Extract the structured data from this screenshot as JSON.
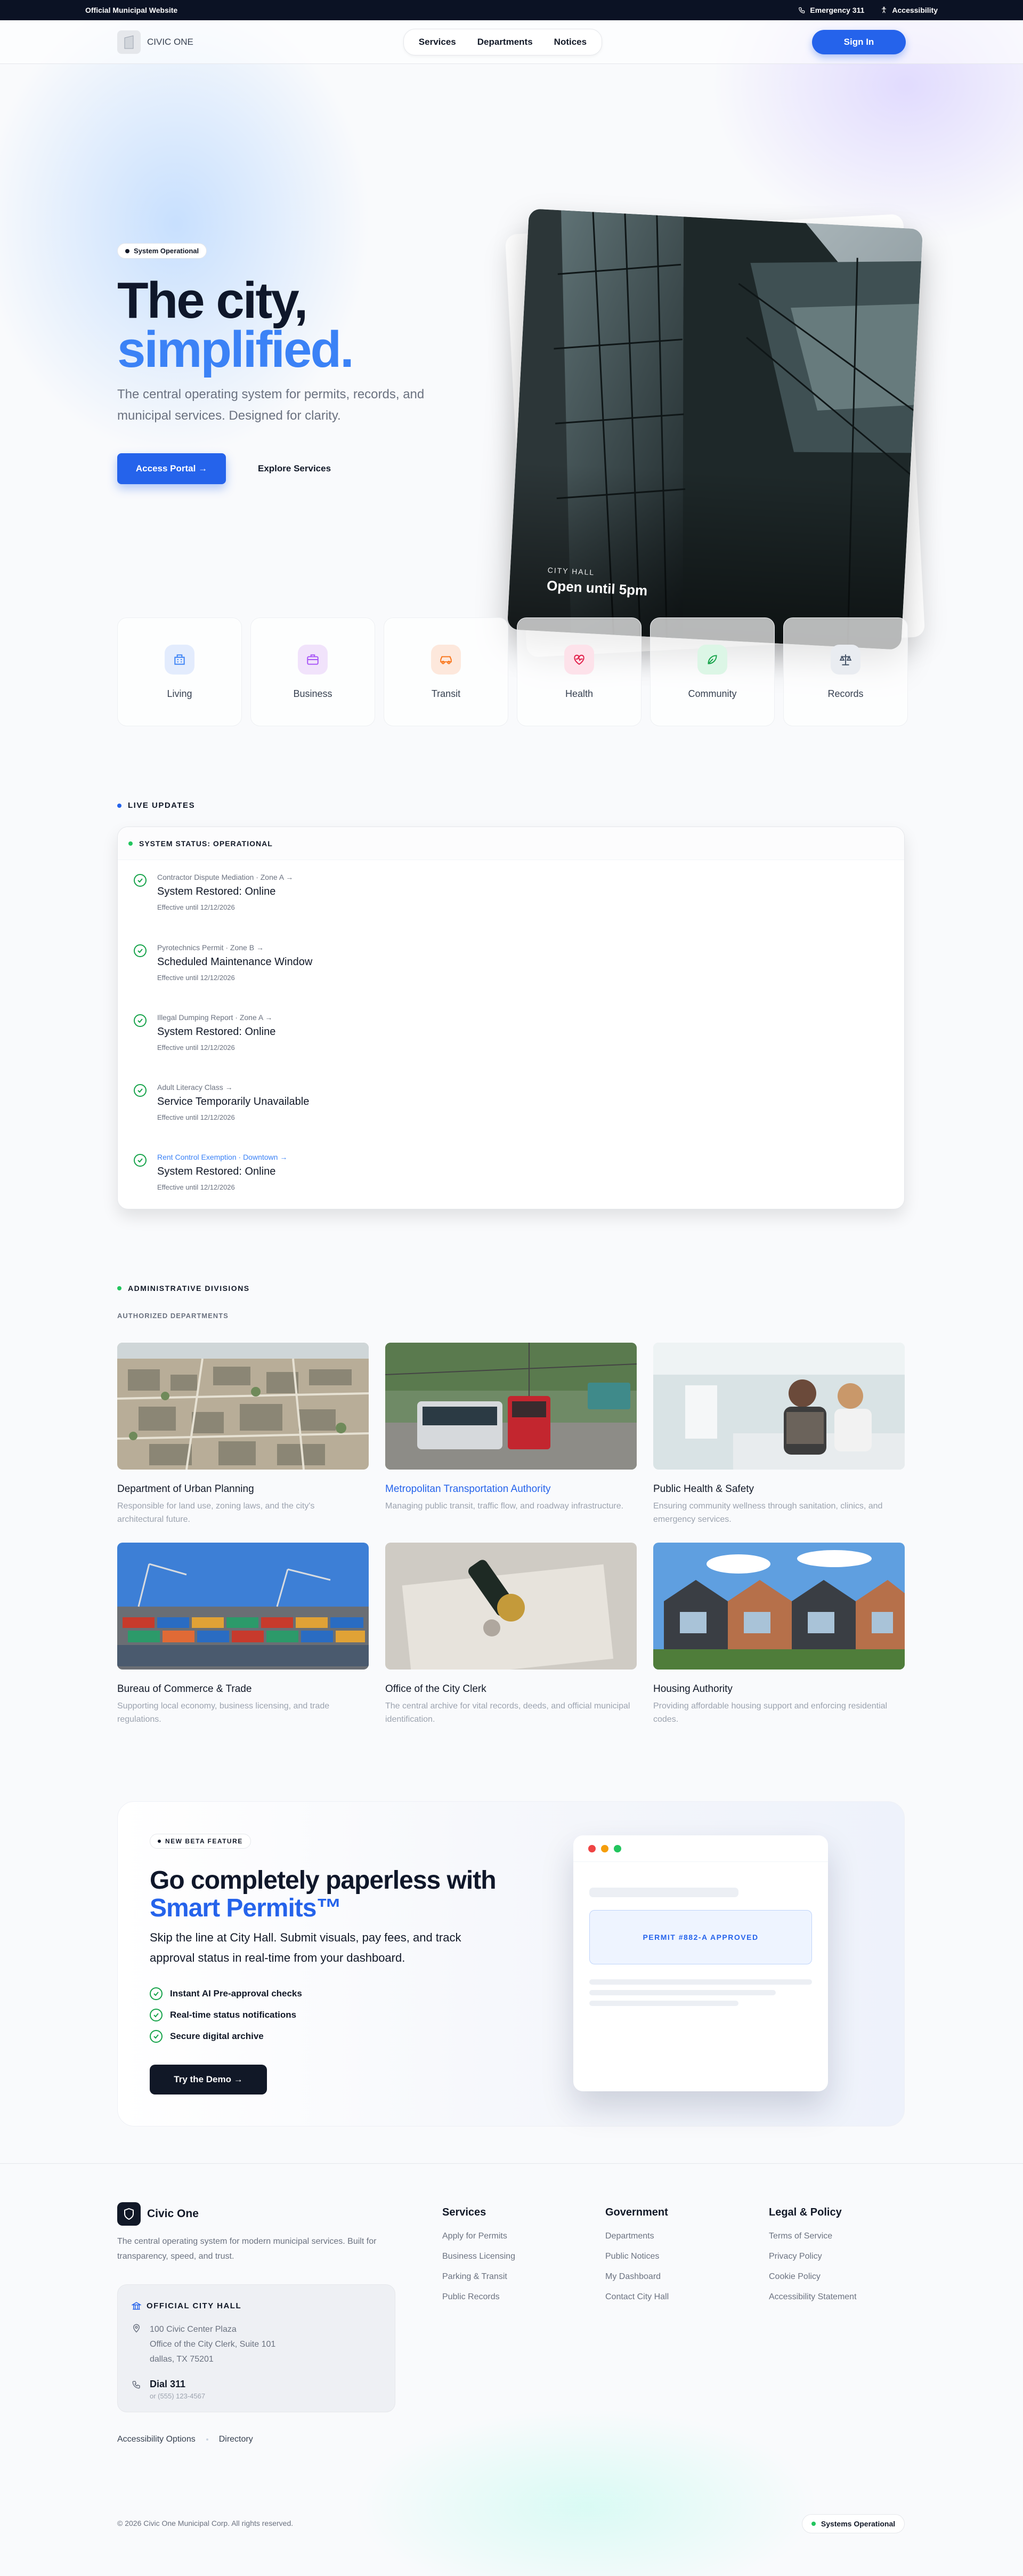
{
  "topbar": {
    "left": "Official Municipal Website",
    "emergency": "Emergency 311",
    "accessibility": "Accessibility"
  },
  "nav": {
    "brand": "CIVIC ONE",
    "links": [
      "Services",
      "Departments",
      "Notices"
    ],
    "signin": "Sign In"
  },
  "hero": {
    "status_pill": "System Operational",
    "title_line1": "The city,",
    "title_line2": "simplified.",
    "lead": "The central operating system for permits, records, and municipal services. Designed for clarity.",
    "primary_cta": "Access Portal →",
    "secondary_cta": "Explore Services",
    "card_eyebrow": "CITY HALL",
    "card_title": "Open until 5pm"
  },
  "categories": [
    {
      "label": "Living",
      "icon": "building-icon",
      "bg": "#e3ecfd",
      "fg": "#3b82f6"
    },
    {
      "label": "Business",
      "icon": "briefcase-icon",
      "bg": "#f1e3fb",
      "fg": "#a855f7"
    },
    {
      "label": "Transit",
      "icon": "car-icon",
      "bg": "#fde8dc",
      "fg": "#f97316"
    },
    {
      "label": "Health",
      "icon": "heart-pulse-icon",
      "bg": "#fde2ea",
      "fg": "#e11d48"
    },
    {
      "label": "Community",
      "icon": "leaf-icon",
      "bg": "#dcf6e6",
      "fg": "#16a34a"
    },
    {
      "label": "Records",
      "icon": "scale-icon",
      "bg": "#e9ecf1",
      "fg": "#475569"
    }
  ],
  "live_updates": {
    "title": "LIVE UPDATES",
    "status_header": "SYSTEM STATUS: OPERATIONAL",
    "items": [
      {
        "meta": "Contractor Dispute Mediation · Zone A →",
        "title": "System Restored: Online",
        "until": "Effective until 12/12/2026"
      },
      {
        "meta": "Pyrotechnics Permit · Zone B →",
        "title": "Scheduled Maintenance Window",
        "until": "Effective until 12/12/2026"
      },
      {
        "meta": "Illegal Dumping Report · Zone A →",
        "title": "System Restored: Online",
        "until": "Effective until 12/12/2026"
      },
      {
        "meta": "Adult Literacy Class →",
        "title": "Service Temporarily Unavailable",
        "until": "Effective until 12/12/2026"
      },
      {
        "meta": "Rent Control Exemption · Downtown →",
        "title": "System Restored: Online",
        "until": "Effective until 12/12/2026"
      }
    ]
  },
  "departments": {
    "title": "ADMINISTRATIVE DIVISIONS",
    "subtitle": "AUTHORIZED DEPARTMENTS",
    "items": [
      {
        "name": "Department of Urban Planning",
        "desc": "Responsible for land use, zoning laws, and the city's architectural future."
      },
      {
        "name": "Metropolitan Transportation Authority",
        "desc": "Managing public transit, traffic flow, and roadway infrastructure."
      },
      {
        "name": "Public Health & Safety",
        "desc": "Ensuring community wellness through sanitation, clinics, and emergency services."
      },
      {
        "name": "Bureau of Commerce & Trade",
        "desc": "Supporting local economy, business licensing, and trade regulations."
      },
      {
        "name": "Office of the City Clerk",
        "desc": "The central archive for vital records, deeds, and official municipal identification."
      },
      {
        "name": "Housing Authority",
        "desc": "Providing affordable housing support and enforcing residential codes."
      }
    ]
  },
  "beta": {
    "pill": "NEW BETA FEATURE",
    "title_line1": "Go completely paperless with",
    "title_line2": "Smart Permits™",
    "body": "Skip the line at City Hall. Submit visuals, pay fees, and track approval status in real-time from your dashboard.",
    "features": [
      "Instant AI Pre-approval checks",
      "Real-time status notifications",
      "Secure digital archive"
    ],
    "cta": "Try the Demo  →",
    "permit_label": "PERMIT #882-A APPROVED"
  },
  "footer": {
    "brand": "Civic One",
    "desc": "The central operating system for modern municipal services. Built for transparency, speed, and trust.",
    "hall_title": "OFFICIAL CITY HALL",
    "address_1": "100 Civic Center Plaza",
    "address_2": "Office of the City Clerk, Suite 101",
    "address_3": "dallas, TX 75201",
    "dial": "Dial 311",
    "phone": "or (555) 123-4567",
    "columns": [
      {
        "title": "Services",
        "links": [
          "Apply for Permits",
          "Business Licensing",
          "Parking & Transit",
          "Public Records"
        ]
      },
      {
        "title": "Government",
        "links": [
          "Departments",
          "Public Notices",
          "My Dashboard",
          "Contact City Hall"
        ]
      },
      {
        "title": "Legal & Policy",
        "links": [
          "Terms of Service",
          "Privacy Policy",
          "Cookie Policy",
          "Accessibility Statement"
        ]
      }
    ],
    "sub_links": [
      "Accessibility Options",
      "Directory"
    ],
    "copyright": "© 2026 Civic One Municipal Corp. All rights reserved.",
    "status": "Systems Operational"
  },
  "colors": {
    "primary": "#2563eb",
    "success": "#22c55e",
    "dark": "#0b1224"
  }
}
